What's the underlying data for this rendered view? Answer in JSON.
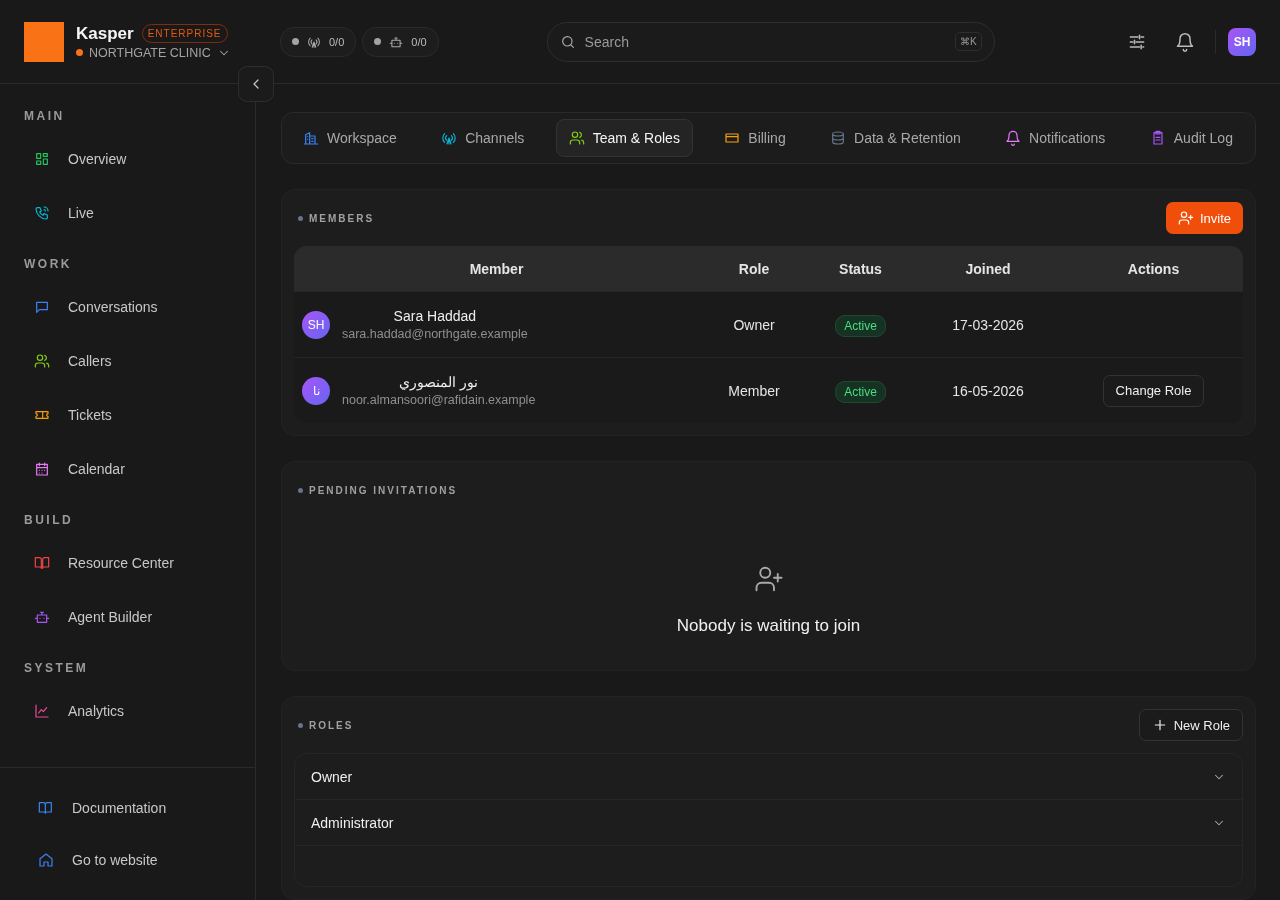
{
  "brand": {
    "name": "Kasper",
    "badge": "ENTERPRISE",
    "org": "NORTHGATE CLINIC"
  },
  "status_chips": [
    {
      "value": "0/0"
    },
    {
      "value": "0/0"
    }
  ],
  "search": {
    "placeholder": "Search",
    "shortcut": "⌘K"
  },
  "user_avatar": {
    "initials": "SH"
  },
  "sidebar": {
    "sections": [
      {
        "title": "MAIN",
        "items": [
          {
            "label": "Overview"
          },
          {
            "label": "Live"
          }
        ]
      },
      {
        "title": "WORK",
        "items": [
          {
            "label": "Conversations"
          },
          {
            "label": "Callers"
          },
          {
            "label": "Tickets"
          },
          {
            "label": "Calendar"
          }
        ]
      },
      {
        "title": "BUILD",
        "items": [
          {
            "label": "Resource Center"
          },
          {
            "label": "Agent Builder"
          }
        ]
      },
      {
        "title": "SYSTEM",
        "items": [
          {
            "label": "Analytics"
          }
        ]
      }
    ],
    "footer": [
      {
        "label": "Documentation"
      },
      {
        "label": "Go to website"
      }
    ]
  },
  "tabs": [
    {
      "label": "Workspace",
      "selected": false
    },
    {
      "label": "Channels",
      "selected": false
    },
    {
      "label": "Team & Roles",
      "selected": true
    },
    {
      "label": "Billing",
      "selected": false
    },
    {
      "label": "Data & Retention",
      "selected": false
    },
    {
      "label": "Notifications",
      "selected": false
    },
    {
      "label": "Audit Log",
      "selected": false
    }
  ],
  "members": {
    "title": "MEMBERS",
    "invite_button": "Invite",
    "columns": [
      "Member",
      "Role",
      "Status",
      "Joined",
      "Actions"
    ],
    "rows": [
      {
        "initials": "SH",
        "name": "Sara Haddad",
        "email": "sara.haddad@northgate.example",
        "role": "Owner",
        "status": "Active",
        "joined": "17-03-2026"
      },
      {
        "initials": "نا",
        "name": "نور المنصوري",
        "email": "noor.almansoori@rafidain.example",
        "role": "Member",
        "status": "Active",
        "joined": "16-05-2026",
        "action": "Change Role"
      }
    ]
  },
  "pending": {
    "title": "PENDING INVITATIONS",
    "empty_text": "Nobody is waiting to join"
  },
  "roles": {
    "title": "ROLES",
    "new_button": "New Role",
    "items": [
      {
        "name": "Owner"
      },
      {
        "name": "Administrator"
      }
    ]
  }
}
